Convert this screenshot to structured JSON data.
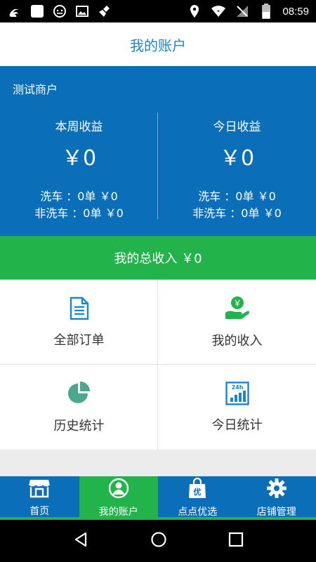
{
  "status_bar": {
    "time": "08:59",
    "left_icons": [
      "uc-browser-icon",
      "app-square-icon",
      "robot-icon",
      "image-icon",
      "broom-icon"
    ],
    "right_icons": [
      "location-icon",
      "wifi-icon",
      "no-signal-icon",
      "battery-icon"
    ]
  },
  "header": {
    "title": "我的账户"
  },
  "account": {
    "merchant_name": "测试商户",
    "week": {
      "label": "本周收益",
      "amount": "￥0",
      "wash_line": "洗车 ：0单 ￥0",
      "non_wash_line": "非洗车 ：0单 ￥0"
    },
    "today": {
      "label": "今日收益",
      "amount": "￥0",
      "wash_line": "洗车 ：0单 ￥0",
      "non_wash_line": "非洗车 ：0单 ￥0"
    }
  },
  "total_income": "我的总收入 ￥0",
  "grid": {
    "all_orders": "全部订单",
    "my_income": "我的收入",
    "history_stats": "历史统计",
    "today_stats": "今日统计",
    "today_stats_icon_text": "24h",
    "my_income_icon_text": "￥"
  },
  "bottom_nav": [
    {
      "label": "首页",
      "icon": "storefront-icon",
      "active": false
    },
    {
      "label": "我的账户",
      "icon": "user-icon",
      "active": true
    },
    {
      "label": "点点优选",
      "icon": "shopping-bag-icon",
      "active": false,
      "icon_text": "优"
    },
    {
      "label": "店铺管理",
      "icon": "gear-icon",
      "active": false
    }
  ],
  "colors": {
    "primary_blue": "#0a6fb8",
    "green": "#22b34b",
    "title_blue": "#1a86d0"
  }
}
